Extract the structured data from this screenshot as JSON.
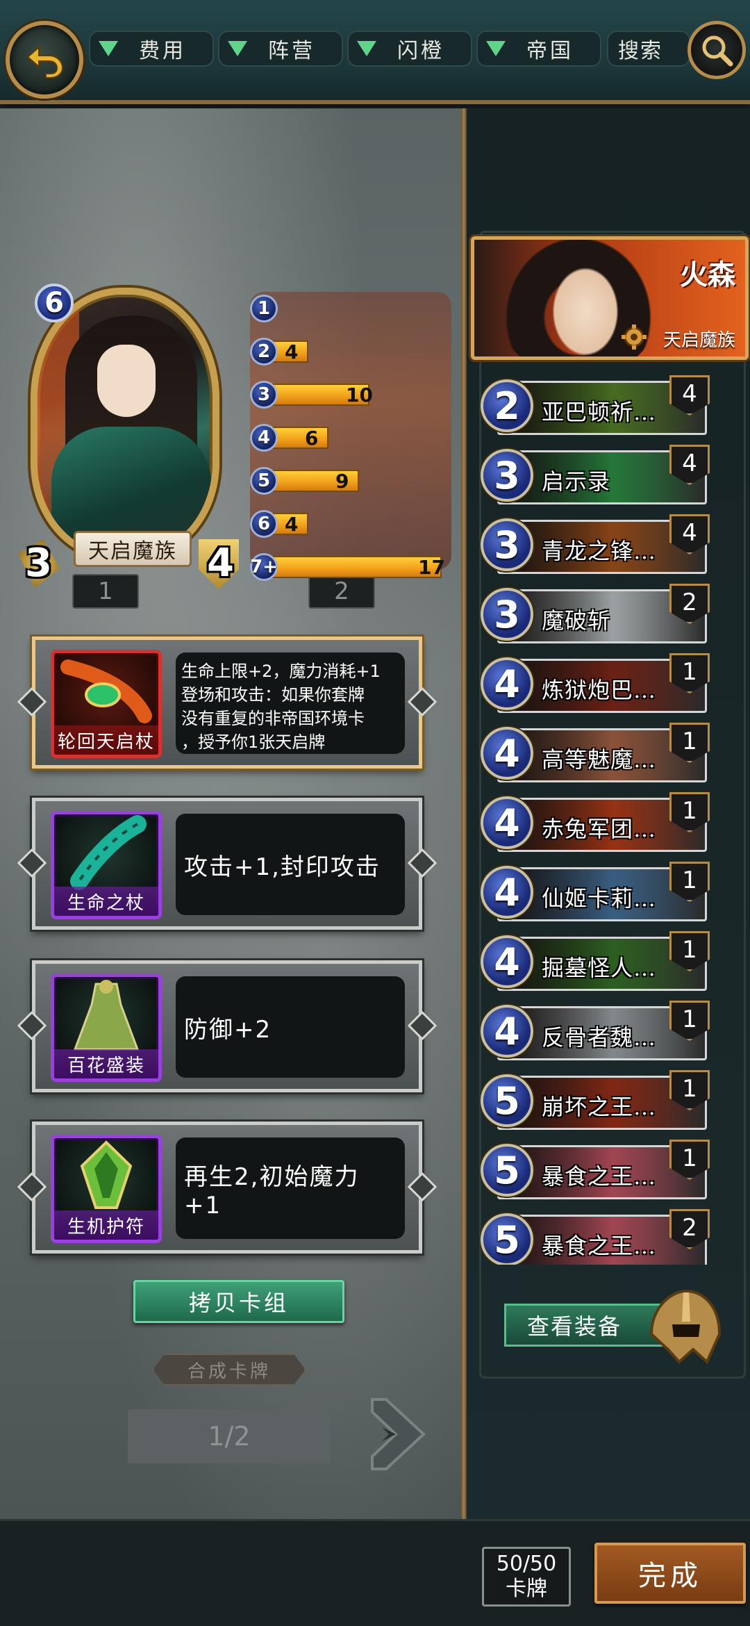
{
  "filters": [
    {
      "label": "费用"
    },
    {
      "label": "阵营"
    },
    {
      "label": "闪橙"
    },
    {
      "label": "帝国"
    }
  ],
  "search": {
    "label": "搜索"
  },
  "featured_card": {
    "cost": "6",
    "attack": "3",
    "health": "4",
    "name": "天启魔族",
    "count": "1",
    "neighbor_count": "2"
  },
  "cost_curve": [
    {
      "cost": "1",
      "count": ""
    },
    {
      "cost": "2",
      "count": "4"
    },
    {
      "cost": "3",
      "count": "10"
    },
    {
      "cost": "4",
      "count": "6"
    },
    {
      "cost": "5",
      "count": "9"
    },
    {
      "cost": "6",
      "count": "4"
    },
    {
      "cost": "7+",
      "count": "17"
    }
  ],
  "cost_curve_levels": [
    0,
    4,
    10,
    6,
    9,
    4,
    17
  ],
  "equipment": [
    {
      "name": "轮回天启杖",
      "desc": "生命上限+2，魔力消耗+1\n登场和攻击：如果你套牌\n没有重复的非帝国环境卡\n，授予你1张天启牌"
    },
    {
      "name": "生命之杖",
      "desc": "攻击+1,封印攻击"
    },
    {
      "name": "百花盛装",
      "desc": "防御+2"
    },
    {
      "name": "生机护符",
      "desc": "再生2,初始魔力+1"
    }
  ],
  "copy_deck": "拷贝卡组",
  "synthesize": "合成卡牌",
  "page": "1/2",
  "hero": {
    "name": "火森",
    "faction": "天启魔族"
  },
  "deck": [
    {
      "cost": "2",
      "name": "亚巴顿祈…",
      "qty": "4",
      "color": "#5b8a2a"
    },
    {
      "cost": "3",
      "name": "启示录",
      "qty": "4",
      "color": "#2f9a4a"
    },
    {
      "cost": "3",
      "name": "青龙之锋…",
      "qty": "4",
      "color": "#b0581c"
    },
    {
      "cost": "3",
      "name": "魔破斩",
      "qty": "2",
      "color": "#c8d0d2"
    },
    {
      "cost": "4",
      "name": "炼狱炮巴…",
      "qty": "1",
      "color": "#8a2a1a"
    },
    {
      "cost": "4",
      "name": "高等魅魔…",
      "qty": "1",
      "color": "#b36a4a"
    },
    {
      "cost": "4",
      "name": "赤兔军团…",
      "qty": "1",
      "color": "#c2401a"
    },
    {
      "cost": "4",
      "name": "仙姬卡莉…",
      "qty": "1",
      "color": "#4a7aa8"
    },
    {
      "cost": "4",
      "name": "掘墓怪人…",
      "qty": "1",
      "color": "#3a7a2a"
    },
    {
      "cost": "4",
      "name": "反骨者魏…",
      "qty": "1",
      "color": "#a8b0b4"
    },
    {
      "cost": "5",
      "name": "崩坏之王…",
      "qty": "1",
      "color": "#a8321a"
    },
    {
      "cost": "5",
      "name": "暴食之王…",
      "qty": "1",
      "color": "#d05a6a"
    },
    {
      "cost": "5",
      "name": "暴食之王…",
      "qty": "2",
      "color": "#d05a6a"
    }
  ],
  "view_equipment": "查看装备",
  "card_count": {
    "value": "50/50",
    "unit": "卡牌"
  },
  "done": "完成",
  "colors": {
    "accent_green": "#5fd48a",
    "gold": "#c7a04f",
    "bar_orange": "#f3a21b"
  }
}
